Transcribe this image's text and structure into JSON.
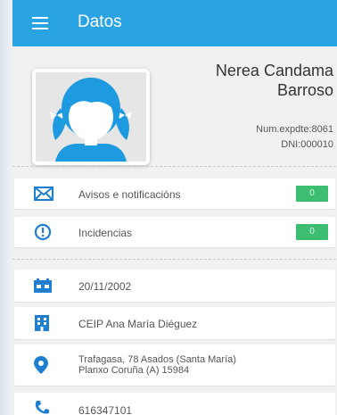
{
  "appbar": {
    "title": "Datos"
  },
  "profile": {
    "name_line1": "Nerea Candama",
    "name_line2": "Barroso",
    "expdte": "Num.expdte:8061",
    "dni": "DNI:000010"
  },
  "notifications": [
    {
      "label": "Avisos e notificacións",
      "count": "0",
      "icon": "envelope-icon"
    },
    {
      "label": "Incidencias",
      "count": "0",
      "icon": "alert-circle-icon"
    }
  ],
  "details": {
    "birthdate": "20/11/2002",
    "school": "CEIP Ana María Diéguez",
    "address_line1": "Trafagasa, 78 Asados (Santa María)",
    "address_line2": "Planxo Coruña (A) 15984",
    "phone": "616347101"
  },
  "colors": {
    "accent": "#2aa3e2",
    "badge": "#3dbd71",
    "icon": "#1e7fd0"
  }
}
